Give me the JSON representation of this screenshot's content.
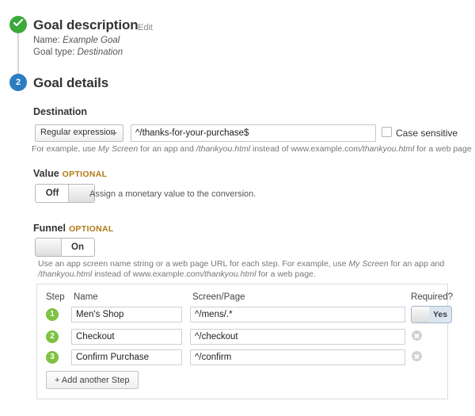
{
  "goal_description": {
    "title": "Goal description",
    "edit_label": "Edit",
    "name_line": "Name: Example Goal",
    "type_line": "Goal type: Destination",
    "status_icon": "check-circle-icon"
  },
  "goal_details": {
    "step_number": "2",
    "title": "Goal details"
  },
  "destination": {
    "heading": "Destination",
    "match_type_selected": "Regular expression",
    "value": "^/thanks-for-your-purchase$",
    "case_sensitive_label": "Case sensitive",
    "case_sensitive_checked": false,
    "hint": "For example, use My Screen for an app and /thankyou.html instead of www.example.com/thankyou.html for a web page"
  },
  "value": {
    "heading": "Value",
    "optional_tag": "OPTIONAL",
    "toggle_state": "Off",
    "hint": "Assign a monetary value to the conversion."
  },
  "funnel": {
    "heading": "Funnel",
    "optional_tag": "OPTIONAL",
    "toggle_state": "On",
    "hint_line1": "Use an app screen name string or a web page URL for each step. For example, use My Screen for an app and",
    "hint_line2": "/thankyou.html instead of www.example.com/thankyou.html for a web page.",
    "columns": {
      "step": "Step",
      "name": "Name",
      "page": "Screen/Page",
      "required": "Required?"
    },
    "steps": [
      {
        "num": "1",
        "name": "Men's Shop",
        "page": "^/mens/.*",
        "required_label": "Yes",
        "required_toggle": true
      },
      {
        "num": "2",
        "name": "Checkout",
        "page": "^/checkout",
        "required_label": "",
        "required_toggle": false
      },
      {
        "num": "3",
        "name": "Confirm Purchase",
        "page": "^/confirm",
        "required_label": "",
        "required_toggle": false
      }
    ],
    "add_step_label": "+ Add another Step"
  },
  "colors": {
    "done_green": "#3ba93b",
    "step_blue": "#2b7dc2",
    "funnel_green": "#7dc242",
    "optional_orange": "#b07a16"
  }
}
